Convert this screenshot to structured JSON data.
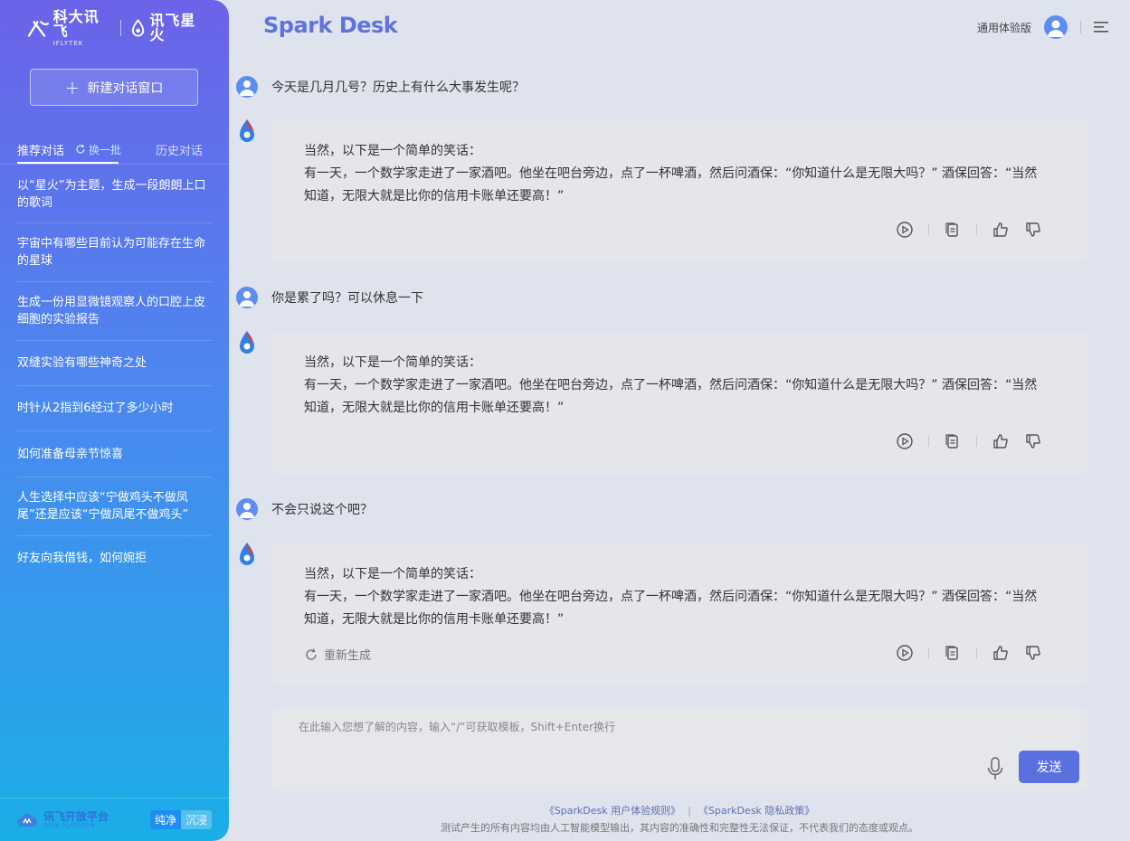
{
  "sidebar": {
    "logo_iflytek_cn": "科大讯飞",
    "logo_iflytek_en": "IFLYTEK",
    "logo_spark_cn": "讯飞星火",
    "new_chat_label": "新建对话窗口",
    "tab_recommend": "推荐对话",
    "refresh_label": "换一批",
    "tab_history": "历史对话",
    "recommendations": [
      "以“星火”为主题，生成一段朗朗上口的歌词",
      "宇宙中有哪些目前认为可能存在生命的星球",
      "生成一份用显微镜观察人的口腔上皮细胞的实验报告",
      "双缝实验有哪些神奇之处",
      "时针从2指到6经过了多少小时",
      "如何准备母亲节惊喜",
      "人生选择中应该“宁做鸡头不做凤尾”还是应该“宁做凤尾不做鸡头”",
      "好友向我借钱，如何婉拒"
    ],
    "open_platform_cn": "讯飞开放平台",
    "open_platform_en": "OPEN PLATFORM",
    "mode_pure": "纯净",
    "mode_immersive": "沉浸"
  },
  "header": {
    "brand": "Spark Desk",
    "version_label": "通用体验版"
  },
  "chat": {
    "messages": [
      {
        "role": "user",
        "text": "今天是几月几号？历史上有什么大事发生呢？"
      },
      {
        "role": "bot",
        "line1": "当然，以下是一个简单的笑话：",
        "line2": "有一天，一个数学家走进了一家酒吧。他坐在吧台旁边，点了一杯啤酒，然后问酒保：“你知道什么是无限大吗？” 酒保回答：“当然知道，无限大就是比你的信用卡账单还要高！”"
      },
      {
        "role": "user",
        "text": "你是累了吗？可以休息一下"
      },
      {
        "role": "bot",
        "line1": "当然，以下是一个简单的笑话：",
        "line2": "有一天，一个数学家走进了一家酒吧。他坐在吧台旁边，点了一杯啤酒，然后问酒保：“你知道什么是无限大吗？” 酒保回答：“当然知道，无限大就是比你的信用卡账单还要高！”"
      },
      {
        "role": "user",
        "text": "不会只说这个吧？"
      },
      {
        "role": "bot",
        "line1": "当然，以下是一个简单的笑话：",
        "line2": "有一天，一个数学家走进了一家酒吧。他坐在吧台旁边，点了一杯啤酒，然后问酒保：“你知道什么是无限大吗？” 酒保回答：“当然知道，无限大就是比你的信用卡账单还要高！”"
      }
    ],
    "regenerate_label": "重新生成"
  },
  "input": {
    "placeholder": "在此输入您想了解的内容，输入“/”可获取模板，Shift+Enter换行",
    "send_label": "发送"
  },
  "footer": {
    "user_rules": "《SparkDesk 用户体验规则》",
    "privacy": "《SparkDesk 隐私政策》",
    "separator": "|",
    "disclaimer": "测试产生的所有内容均由人工智能模型输出，其内容的准确性和完整性无法保证，不代表我们的态度或观点。"
  },
  "colors": {
    "accent": "#5a6fe0",
    "sidebar_top": "#6b63e8",
    "sidebar_bottom": "#1aaee8",
    "brand": "#5f73dd"
  }
}
